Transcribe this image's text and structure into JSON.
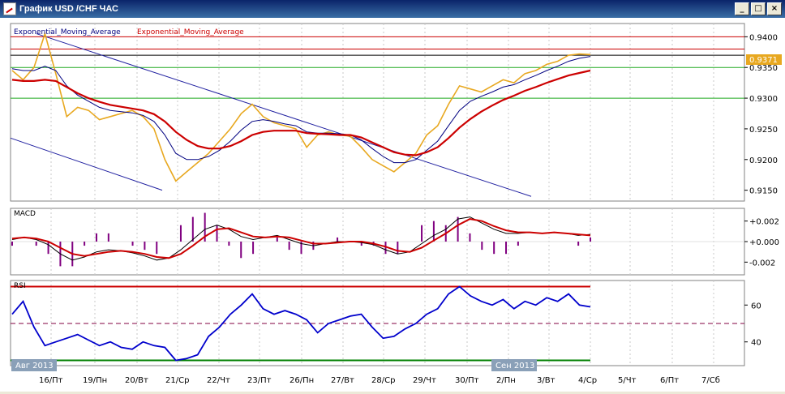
{
  "window": {
    "title": "График USD /CHF ЧАС",
    "buttons": {
      "minimize": "_",
      "maximize": "□",
      "close": "×"
    }
  },
  "price_panel": {
    "legend_1": "Exponential_Moving_Average",
    "legend_2": "Exponential_Moving_Average",
    "current_price": "0.9371",
    "colors": {
      "price": "#e8a820",
      "ema_fast": "#000080",
      "ema_slow": "#cc0000"
    }
  },
  "macd_panel": {
    "label": "MACD"
  },
  "rsi_panel": {
    "label": "RSI"
  },
  "chart_data": [
    {
      "type": "line",
      "ylim": [
        0.9135,
        0.9415
      ],
      "yticks": [
        "0.9400",
        "0.9350",
        "0.9300",
        "0.9250",
        "0.9200",
        "0.9150"
      ],
      "hlines": [
        0.94,
        0.938,
        0.937,
        0.935,
        0.93
      ],
      "series": [
        {
          "values": [
            0.9345,
            0.933,
            0.935,
            0.9405,
            0.934,
            0.927,
            0.9285,
            0.928,
            0.9265,
            0.927,
            0.9275,
            0.928,
            0.927,
            0.925,
            0.92,
            0.9165,
            0.918,
            0.9195,
            0.921,
            0.923,
            0.925,
            0.9275,
            0.929,
            0.927,
            0.926,
            0.9255,
            0.925,
            0.922,
            0.924,
            0.9245,
            0.924,
            0.9238,
            0.922,
            0.92,
            0.919,
            0.918,
            0.9195,
            0.921,
            0.924,
            0.9255,
            0.929,
            0.932,
            0.9315,
            0.931,
            0.932,
            0.933,
            0.9325,
            0.934,
            0.9345,
            0.9355,
            0.936,
            0.937,
            0.9372,
            0.9371
          ]
        },
        {
          "values": [
            0.9348,
            0.9345,
            0.9345,
            0.9352,
            0.9345,
            0.932,
            0.9305,
            0.9295,
            0.9285,
            0.928,
            0.9278,
            0.9276,
            0.9272,
            0.9262,
            0.924,
            0.921,
            0.92,
            0.92,
            0.9205,
            0.9215,
            0.923,
            0.9248,
            0.9262,
            0.9265,
            0.9262,
            0.9258,
            0.9255,
            0.9245,
            0.9243,
            0.9243,
            0.9242,
            0.924,
            0.9232,
            0.9218,
            0.9205,
            0.9195,
            0.9195,
            0.92,
            0.9215,
            0.923,
            0.9255,
            0.928,
            0.9295,
            0.9303,
            0.931,
            0.9318,
            0.9322,
            0.933,
            0.9337,
            0.9345,
            0.9352,
            0.936,
            0.9365,
            0.9368
          ]
        },
        {
          "values": [
            0.933,
            0.9328,
            0.9328,
            0.933,
            0.9328,
            0.9318,
            0.9308,
            0.93,
            0.9294,
            0.9289,
            0.9286,
            0.9283,
            0.928,
            0.9274,
            0.9262,
            0.9245,
            0.9232,
            0.9222,
            0.9218,
            0.9218,
            0.9222,
            0.923,
            0.924,
            0.9245,
            0.9247,
            0.9247,
            0.9247,
            0.9243,
            0.9242,
            0.9241,
            0.924,
            0.924,
            0.9236,
            0.9228,
            0.922,
            0.9212,
            0.9208,
            0.9207,
            0.9212,
            0.922,
            0.9235,
            0.9252,
            0.9266,
            0.9278,
            0.9288,
            0.9297,
            0.9304,
            0.9312,
            0.9318,
            0.9325,
            0.9331,
            0.9337,
            0.9341,
            0.9345
          ]
        }
      ]
    },
    {
      "type": "line",
      "ylim": [
        -0.003,
        0.003
      ],
      "yticks": [
        "+0.002",
        "+0.000",
        "-0.002"
      ],
      "series": [
        {
          "values": [
            0.0002,
            0.0004,
            0.0002,
            -0.0003,
            -0.0012,
            -0.0018,
            -0.0015,
            -0.001,
            -0.0008,
            -0.0009,
            -0.0011,
            -0.0014,
            -0.0018,
            -0.0016,
            -0.0008,
            0.0002,
            0.0012,
            0.0016,
            0.0012,
            0.0005,
            0.0002,
            0.0004,
            0.0006,
            0.0002,
            -0.0002,
            -0.0004,
            -0.0002,
            0.0,
            0.0,
            -0.0001,
            -0.0003,
            -0.0008,
            -0.0012,
            -0.001,
            -0.0002,
            0.0006,
            0.0012,
            0.0022,
            0.0024,
            0.0018,
            0.0012,
            0.0008,
            0.0008,
            0.0009,
            0.0008,
            0.0009,
            0.0008,
            0.0006,
            0.0007
          ]
        },
        {
          "values": [
            0.0003,
            0.0004,
            0.0003,
            0.0,
            -0.0006,
            -0.0012,
            -0.0014,
            -0.0012,
            -0.001,
            -0.0009,
            -0.001,
            -0.0012,
            -0.0015,
            -0.0016,
            -0.0012,
            -0.0004,
            0.0005,
            0.0012,
            0.0013,
            0.0009,
            0.0005,
            0.0004,
            0.0005,
            0.0004,
            0.0001,
            -0.0002,
            -0.0002,
            -0.0001,
            0.0,
            0.0,
            -0.0002,
            -0.0005,
            -0.0009,
            -0.001,
            -0.0006,
            0.0001,
            0.0008,
            0.0016,
            0.0022,
            0.002,
            0.0015,
            0.0011,
            0.0009,
            0.0009,
            0.0008,
            0.0009,
            0.0008,
            0.0007,
            0.0006
          ]
        }
      ]
    },
    {
      "type": "line",
      "ylim": [
        28,
        72
      ],
      "yticks": [
        "60",
        "40"
      ],
      "hlines": [
        70,
        50,
        30
      ],
      "series": [
        {
          "values": [
            55,
            62,
            48,
            38,
            40,
            42,
            44,
            41,
            38,
            40,
            37,
            36,
            40,
            38,
            37,
            30,
            31,
            33,
            43,
            48,
            55,
            60,
            66,
            58,
            55,
            57,
            55,
            52,
            45,
            50,
            52,
            54,
            55,
            48,
            42,
            43,
            47,
            50,
            55,
            58,
            66,
            70,
            65,
            62,
            60,
            63,
            58,
            62,
            60,
            64,
            62,
            66,
            60,
            59
          ]
        }
      ]
    }
  ],
  "x_axis": {
    "labels": [
      "16/Пт",
      "19/Пн",
      "20/Вт",
      "21/Ср",
      "22/Чт",
      "23/Пт",
      "26/Пн",
      "27/Вт",
      "28/Ср",
      "29/Чт",
      "30/Пт",
      "2/Пн",
      "3/Вт",
      "4/Ср",
      "5/Чт",
      "6/Пт",
      "7/Сб"
    ],
    "month_tags": [
      "Авг 2013",
      "Сен 2013"
    ]
  }
}
